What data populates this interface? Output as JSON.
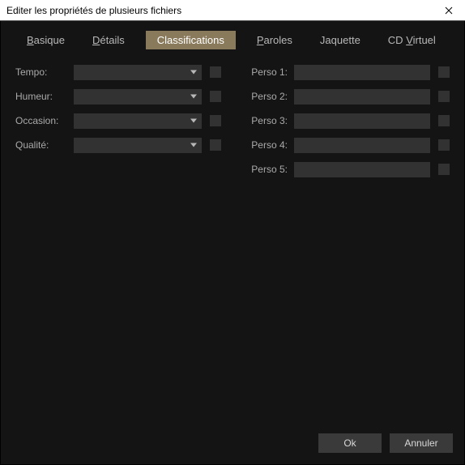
{
  "window": {
    "title": "Editer les propriétés de plusieurs fichiers"
  },
  "tabs": {
    "basique": "asique",
    "basique_u": "B",
    "details": "étails",
    "details_u": "D",
    "classifications": "Classifications",
    "paroles": "aroles",
    "paroles_u": "P",
    "jaquette": "Jaquette",
    "cdvirtuel_pre": "CD ",
    "cdvirtuel_u": "V",
    "cdvirtuel_post": "irtuel"
  },
  "left": {
    "tempo": "Tempo:",
    "humeur": "Humeur:",
    "occasion": "Occasion:",
    "qualite": "Qualité:"
  },
  "right": {
    "perso1": "Perso 1:",
    "perso2": "Perso 2:",
    "perso3": "Perso 3:",
    "perso4": "Perso 4:",
    "perso5": "Perso 5:"
  },
  "footer": {
    "ok": "Ok",
    "cancel": "Annuler"
  }
}
